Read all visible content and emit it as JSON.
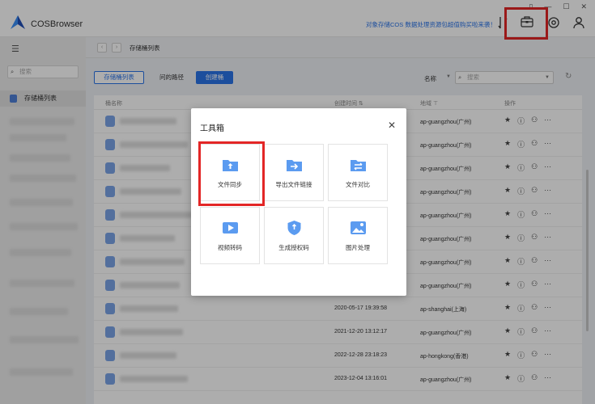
{
  "app": {
    "title": "COSBrowser",
    "promo_link": "对象存储COS 数据处理资源包超值购买啦来袭！",
    "window_controls": [
      "▯",
      "—",
      "☐",
      "✕"
    ]
  },
  "header_icons": [
    "sync-icon",
    "toolbox-icon",
    "settings-icon",
    "user-icon"
  ],
  "sidebar": {
    "search_placeholder": "搜索",
    "items": [
      {
        "label": "存储桶列表"
      }
    ]
  },
  "breadcrumb": {
    "back": "‹",
    "forward": "›",
    "current": "存储桶列表"
  },
  "toolbar": {
    "bucket_list_button": "存储桶列表",
    "path_button": "问的路径",
    "create_button": "创建桶",
    "sort_label": "名称",
    "search_placeholder": "搜索",
    "refresh": "↻"
  },
  "table": {
    "headers": {
      "name": "桶名称",
      "created": "创建时间 ⇅",
      "region": "地域 ⊤",
      "actions": "操作"
    },
    "rows": [
      {
        "created": "",
        "region": "ap-guangzhou(广州)"
      },
      {
        "created": "",
        "region": "ap-guangzhou(广州)"
      },
      {
        "created": "",
        "region": "ap-guangzhou(广州)"
      },
      {
        "created": "",
        "region": "ap-guangzhou(广州)"
      },
      {
        "created": "",
        "region": "ap-guangzhou(广州)"
      },
      {
        "created": "",
        "region": "ap-guangzhou(广州)"
      },
      {
        "created": "",
        "region": "ap-guangzhou(广州)"
      },
      {
        "created": "",
        "region": "ap-guangzhou(广州)"
      },
      {
        "created": "2020-05-17 19:39:58",
        "region": "ap-shanghai(上海)"
      },
      {
        "created": "2021-12-20 13:12:17",
        "region": "ap-guangzhou(广州)"
      },
      {
        "created": "2022-12-28 23:18:23",
        "region": "ap-hongkong(香港)"
      },
      {
        "created": "2023-12-04 13:16:01",
        "region": "ap-guangzhou(广州)"
      }
    ],
    "row_actions": [
      "★",
      "ⓘ",
      "⚇",
      "···"
    ]
  },
  "toolbox": {
    "title": "工具箱",
    "close": "✕",
    "tools": [
      {
        "label": "文件同步",
        "icon": "folder-upload-icon"
      },
      {
        "label": "导出文件链接",
        "icon": "folder-export-icon"
      },
      {
        "label": "文件对比",
        "icon": "compare-icon"
      },
      {
        "label": "视频转码",
        "icon": "video-icon"
      },
      {
        "label": "生成授权码",
        "icon": "shield-key-icon"
      },
      {
        "label": "图片处理",
        "icon": "image-edit-icon"
      }
    ]
  },
  "colors": {
    "accent": "#2a73e8",
    "highlight": "#e32626",
    "icon_blue": "#5b9bf0"
  }
}
